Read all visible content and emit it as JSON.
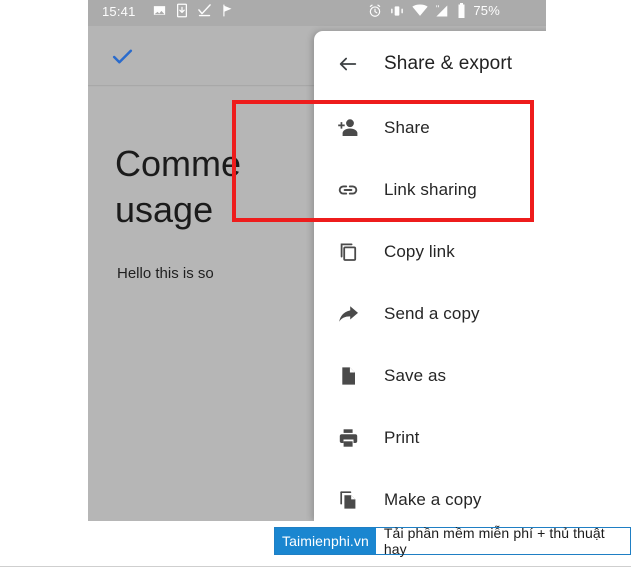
{
  "status_bar": {
    "clock": "15:41",
    "battery_percent": "75%",
    "left_icons": [
      "image-icon",
      "sim-download-icon",
      "checkbox-check-icon",
      "flag-icon"
    ],
    "right_icons": [
      "alarm-icon",
      "vibrate-icon",
      "wifi-icon",
      "signal-icon",
      "battery-icon"
    ]
  },
  "document": {
    "toolbar_icon": "check-icon",
    "title": "Comme\nusage",
    "paragraph": "Hello this is so"
  },
  "sheet": {
    "title": "Share & export",
    "back_icon": "back-arrow-icon",
    "items": [
      {
        "label": "Share",
        "icon": "person-add-icon",
        "toggle": null
      },
      {
        "label": "Link sharing",
        "icon": "link-icon",
        "toggle": "off"
      },
      {
        "label": "Copy link",
        "icon": "copy-icon",
        "toggle": null
      },
      {
        "label": "Send a copy",
        "icon": "share-arrow-icon",
        "toggle": null
      },
      {
        "label": "Save as",
        "icon": "file-icon",
        "toggle": null
      },
      {
        "label": "Print",
        "icon": "printer-icon",
        "toggle": null
      },
      {
        "label": "Make a copy",
        "icon": "duplicate-file-icon",
        "toggle": null
      }
    ]
  },
  "highlight": {
    "color": "#ee1c1c",
    "label": "share-and-link-sharing-highlight"
  },
  "watermark": {
    "brand": "Taimienphi.vn",
    "text": "Tải phần mềm miễn phí + thủ thuật hay",
    "brand_color": "#1a86d0"
  }
}
